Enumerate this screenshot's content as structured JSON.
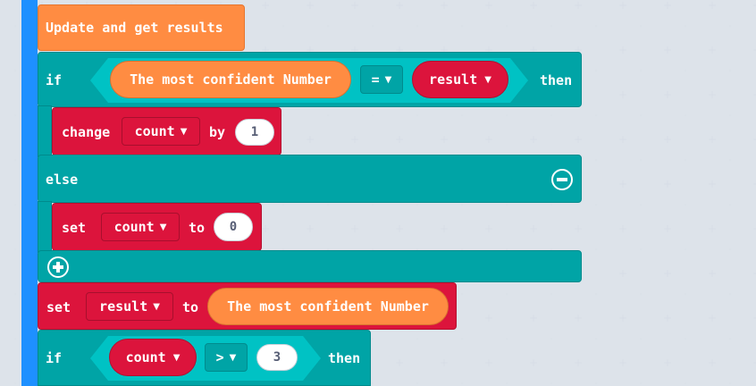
{
  "colors": {
    "loop": "#00a4a6",
    "variable": "#dc143c",
    "ml": "#ff8c42",
    "stripe": "#1e90ff"
  },
  "header_block": {
    "label": "Update and get results"
  },
  "if_block_1": {
    "if_label": "if",
    "left": "The most confident Number",
    "operator": "=",
    "right": "result",
    "then_label": "then"
  },
  "change_block": {
    "keyword": "change",
    "variable": "count",
    "by_label": "by",
    "value": "1"
  },
  "else_label": "else",
  "set_block_1": {
    "keyword": "set",
    "variable": "count",
    "to_label": "to",
    "value": "0"
  },
  "set_block_2": {
    "keyword": "set",
    "variable": "result",
    "to_label": "to",
    "value": "The most confident Number"
  },
  "if_block_2": {
    "if_label": "if",
    "left": "count",
    "operator": ">",
    "right": "3",
    "then_label": "then"
  },
  "icons": {
    "minus": "minus-circle-icon",
    "plus": "plus-circle-icon",
    "caret": "chevron-down-icon"
  }
}
